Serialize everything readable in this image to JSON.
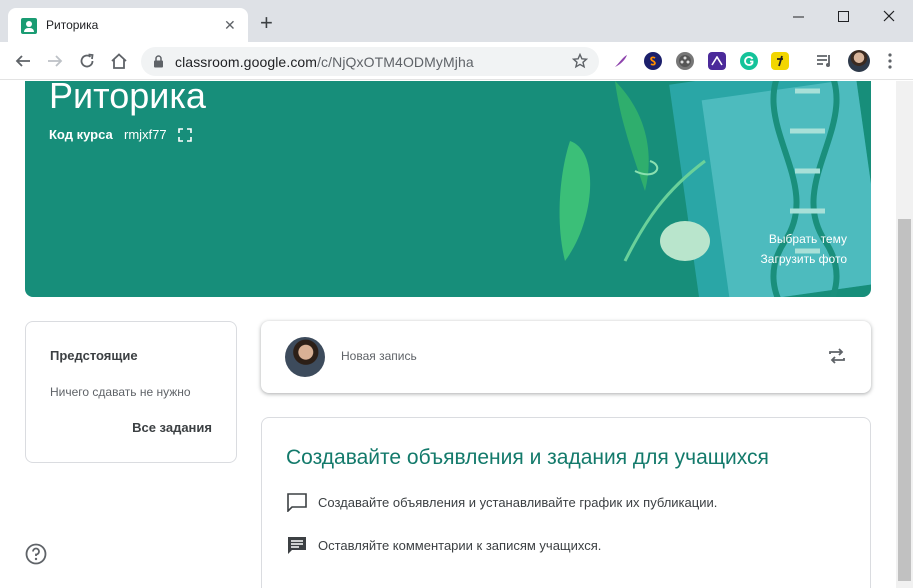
{
  "browser": {
    "tab_title": "Риторика",
    "url_host": "classroom.google.com",
    "url_path": "/c/NjQxOTM4ODMyMjha"
  },
  "banner": {
    "title": "Риторика",
    "course_code_label": "Код курса",
    "course_code": "rmjxf77",
    "choose_theme": "Выбрать тему",
    "upload_photo": "Загрузить фото",
    "color": "#178e7a"
  },
  "upcoming": {
    "title": "Предстоящие",
    "empty_text": "Ничего сдавать не нужно",
    "all_link": "Все задания"
  },
  "post": {
    "placeholder": "Новая запись"
  },
  "info": {
    "title": "Создавайте объявления и задания для учащихся",
    "items": [
      {
        "icon": "comment-icon",
        "text": "Создавайте объявления и устанавливайте график их публикации."
      },
      {
        "icon": "comments-list-icon",
        "text": "Оставляйте комментарии к записям учащихся."
      }
    ]
  }
}
